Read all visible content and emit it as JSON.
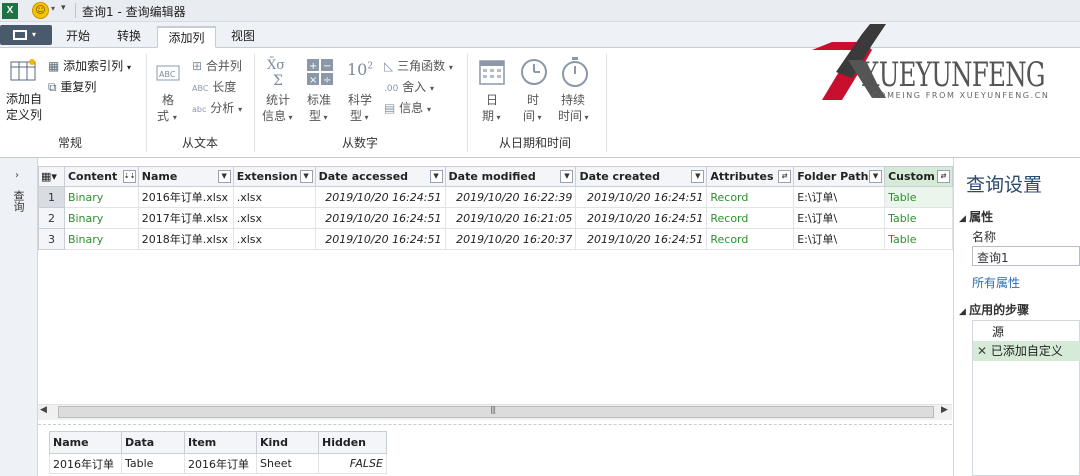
{
  "titlebar": {
    "app_icon": "excel-icon",
    "title": "查询1 - 查询编辑器"
  },
  "tabs": [
    {
      "label": "开始"
    },
    {
      "label": "转换"
    },
    {
      "label": "添加列",
      "active": true
    },
    {
      "label": "视图"
    }
  ],
  "ribbon": {
    "general": {
      "add_custom_col": "添加自定义列",
      "add_custom_col_l1": "添加自",
      "add_custom_col_l2": "定义列",
      "add_index_col": "添加索引列",
      "dup_col": "重复列",
      "label": "常规"
    },
    "from_text": {
      "format_l1": "格",
      "format_l2": "式",
      "merge_cols": "合并列",
      "length": "长度",
      "parse": "分析",
      "label": "从文本"
    },
    "from_number": {
      "stats_l1": "统计",
      "stats_l2": "信息",
      "standard_l1": "标准",
      "standard_l2": "型",
      "scientific_l1": "科学",
      "scientific_l2": "型",
      "trig": "三角函数",
      "rounding": "舍入",
      "info": "信息",
      "label": "从数字"
    },
    "from_datetime": {
      "date_l1": "日",
      "date_l2": "期",
      "time_l1": "时",
      "time_l2": "间",
      "duration_l1": "持续",
      "duration_l2": "时间",
      "label": "从日期和时间"
    },
    "logo": {
      "text": "XUEYUNFENG",
      "subtext": "COMEING FROM XUEYUNFENG.CN"
    }
  },
  "leftnav": {
    "label": "查询"
  },
  "grid": {
    "columns": [
      "Content",
      "Name",
      "Extension",
      "Date accessed",
      "Date modified",
      "Date created",
      "Attributes",
      "Folder Path",
      "Custom"
    ],
    "rows": [
      {
        "n": "1",
        "content": "Binary",
        "name": "2016年订单.xlsx",
        "ext": ".xlsx",
        "accessed": "2019/10/20 16:24:51",
        "modified": "2019/10/20 16:22:39",
        "created": "2019/10/20 16:24:51",
        "attr": "Record",
        "path": "E:\\订单\\",
        "custom": "Table"
      },
      {
        "n": "2",
        "content": "Binary",
        "name": "2017年订单.xlsx",
        "ext": ".xlsx",
        "accessed": "2019/10/20 16:24:51",
        "modified": "2019/10/20 16:21:05",
        "created": "2019/10/20 16:24:51",
        "attr": "Record",
        "path": "E:\\订单\\",
        "custom": "Table"
      },
      {
        "n": "3",
        "content": "Binary",
        "name": "2018年订单.xlsx",
        "ext": ".xlsx",
        "accessed": "2019/10/20 16:24:51",
        "modified": "2019/10/20 16:20:37",
        "created": "2019/10/20 16:24:51",
        "attr": "Record",
        "path": "E:\\订单\\",
        "custom": "Table"
      }
    ]
  },
  "preview": {
    "columns": [
      "Name",
      "Data",
      "Item",
      "Kind",
      "Hidden"
    ],
    "row": {
      "name": "2016年订单",
      "data": "Table",
      "item": "2016年订单",
      "kind": "Sheet",
      "hidden": "FALSE"
    }
  },
  "settings": {
    "title": "查询设置",
    "props_header": "属性",
    "name_label": "名称",
    "name_value": "查询1",
    "all_props": "所有属性",
    "steps_header": "应用的步骤",
    "steps": [
      "源",
      "已添加自定义"
    ]
  },
  "colors": {
    "accent_green": "#2f8f2f",
    "title_blue": "#2c4a6e",
    "link_blue": "#2a6cb7",
    "selected_step": "#d6ebd7"
  }
}
